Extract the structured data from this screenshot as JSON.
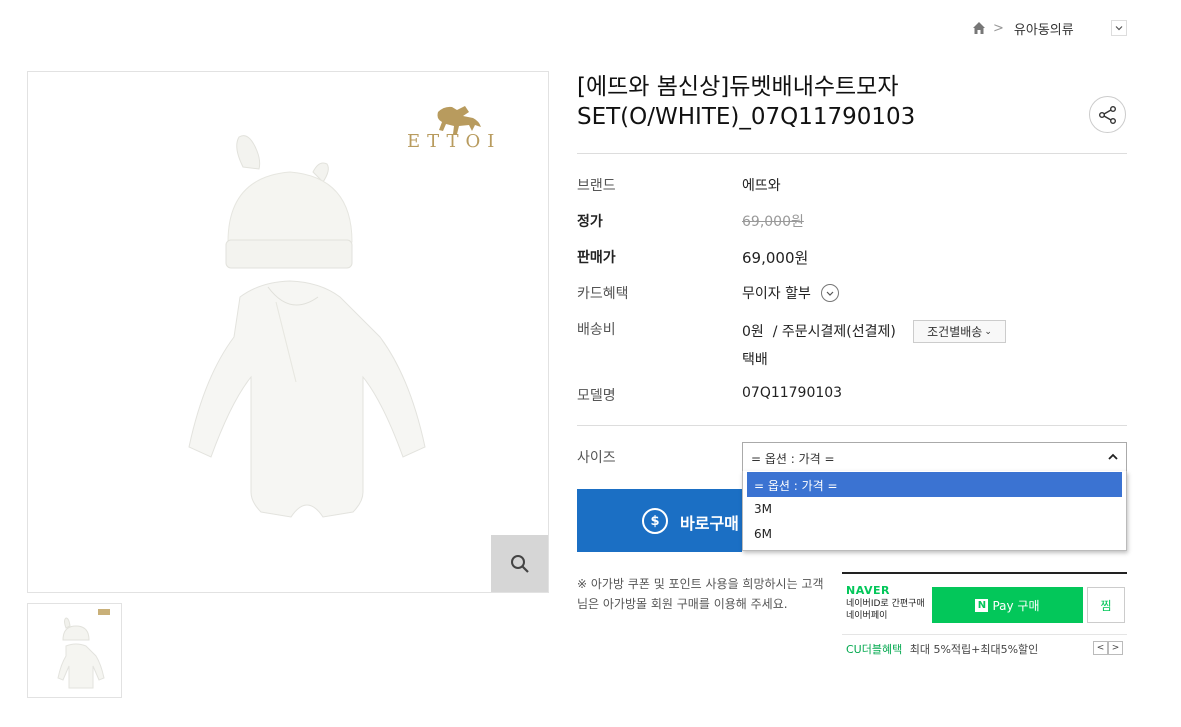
{
  "breadcrumb": {
    "category": "유아동의류"
  },
  "product": {
    "title": "[에뜨와 봄신상]듀벳배내수트모자SET(O/WHITE)_07Q11790103",
    "brand_label": "브랜드",
    "brand_value": "에뜨와",
    "list_price_label": "정가",
    "list_price_value": "69,000원",
    "sale_price_label": "판매가",
    "sale_price_value": "69,000원",
    "card_label": "카드혜택",
    "card_value": "무이자 할부",
    "shipping_label": "배송비",
    "shipping_value": "0원  / 주문시결제(선결제)",
    "shipping_cond_button": "조건별배송",
    "shipping_method": "택배",
    "model_label": "모델명",
    "model_value": "07Q11790103",
    "brand_logo_text": "ETTOI"
  },
  "options": {
    "size_label": "사이즈",
    "selected": "= 옵션 : 가격 =",
    "items": [
      "= 옵션 : 가격 =",
      "3M",
      "6M"
    ]
  },
  "buy": {
    "label": "바로구매",
    "icon": "dollar-icon"
  },
  "notice": "※ 아가방 쿠폰 및 포인트 사용을 희망하시는 고객님은 아가방몰 회원 구매를 이용해 주세요.",
  "naver": {
    "logo": "NAVER",
    "sub1": "네이버ID로 간편구매",
    "sub2": "네이버페이",
    "pay_label": "Pay 구매",
    "pay_n": "N",
    "jjim_label": "찜",
    "benefit_label": "CU더블혜택",
    "benefit_text": "최대 5%적립+최대5%할인"
  },
  "colors": {
    "buy_blue": "#1b6fc4",
    "naver_green": "#03c75a",
    "option_highlight": "#3b73d2"
  }
}
